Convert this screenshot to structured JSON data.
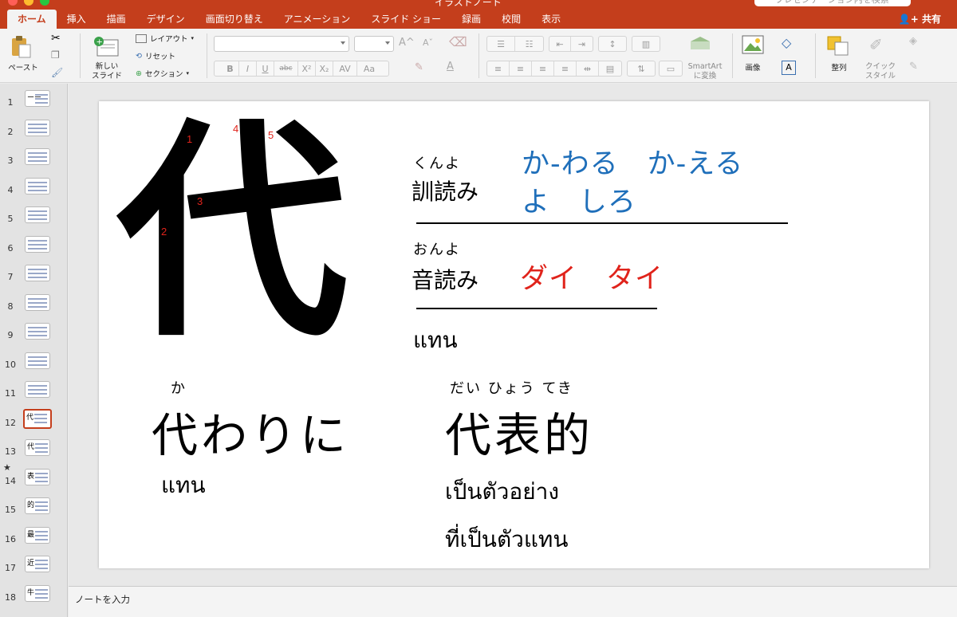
{
  "window": {
    "title": "イラストノート",
    "search_placeholder": "プレゼンテーション内を検索",
    "share_label": "共有"
  },
  "tabs": [
    {
      "label": "ホーム",
      "active": true
    },
    {
      "label": "挿入"
    },
    {
      "label": "描画"
    },
    {
      "label": "デザイン"
    },
    {
      "label": "画面切り替え"
    },
    {
      "label": "アニメーション"
    },
    {
      "label": "スライド ショー"
    },
    {
      "label": "録画"
    },
    {
      "label": "校閲"
    },
    {
      "label": "表示"
    }
  ],
  "ribbon": {
    "paste_label": "ペースト",
    "new_slide_label": "新しい\nスライド",
    "layout_label": "レイアウト",
    "reset_label": "リセット",
    "section_label": "セクション",
    "smartart_label": "SmartArt\nに変換",
    "picture_label": "画像",
    "arrange_label": "整列",
    "quick_style_label": "クイック\nスタイル",
    "bold": "B",
    "italic": "I",
    "underline": "U",
    "strike": "abc",
    "superscript": "X²",
    "subscript": "X₂",
    "spacing": "AV",
    "case": "Aa",
    "grow": "A",
    "shrink": "A",
    "font_color": "A"
  },
  "slides": [
    {
      "num": "1",
      "glyph": "ーー"
    },
    {
      "num": "2",
      "glyph": ""
    },
    {
      "num": "3",
      "glyph": ""
    },
    {
      "num": "4",
      "glyph": ""
    },
    {
      "num": "5",
      "glyph": ""
    },
    {
      "num": "6",
      "glyph": ""
    },
    {
      "num": "7",
      "glyph": ""
    },
    {
      "num": "8",
      "glyph": ""
    },
    {
      "num": "9",
      "glyph": ""
    },
    {
      "num": "10",
      "glyph": ""
    },
    {
      "num": "11",
      "glyph": ""
    },
    {
      "num": "12",
      "glyph": "代",
      "selected": true
    },
    {
      "num": "13",
      "glyph": "代"
    },
    {
      "num": "14",
      "glyph": "表",
      "star": true
    },
    {
      "num": "15",
      "glyph": "的"
    },
    {
      "num": "16",
      "glyph": "最"
    },
    {
      "num": "17",
      "glyph": "近"
    },
    {
      "num": "18",
      "glyph": "牛"
    }
  ],
  "slide": {
    "kanji": "代",
    "stroke_numbers": [
      "1",
      "2",
      "3",
      "4",
      "5"
    ],
    "kun_furigana": "くんよ",
    "kun_label": "訓読み",
    "kun_readings_1": "か-わる　か-える",
    "kun_readings_2": "よ　しろ",
    "on_furigana": "おんよ",
    "on_label": "音読み",
    "on_readings": "ダイ　タイ",
    "thai_meaning": "แทน",
    "word1_furigana": "か",
    "word1": "代わりに",
    "word1_thai": "แทน",
    "word2_furigana": "だい ひょう てき",
    "word2": "代表的",
    "word2_thai_1": "เป็นตัวอย่าง",
    "word2_thai_2": "ที่เป็นตัวแทน"
  },
  "notes": {
    "placeholder": "ノートを入力"
  },
  "colors": {
    "accent": "#c43e1c",
    "kun_blue": "#1f6fba",
    "on_red": "#e0231b"
  }
}
